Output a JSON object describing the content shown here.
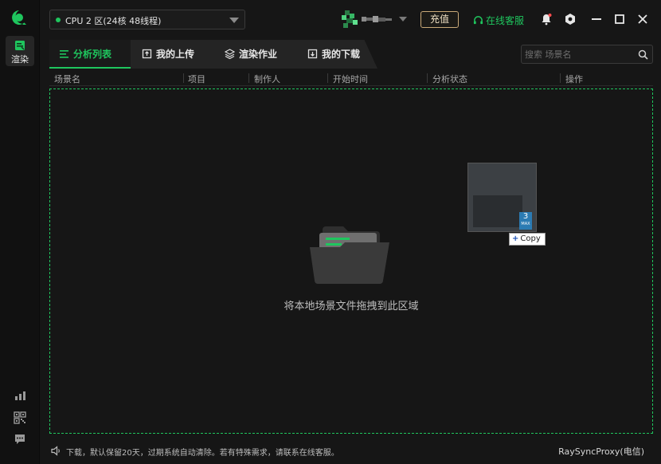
{
  "rail": {
    "render_label": "渲染"
  },
  "topbar": {
    "cpu_zone": "CPU 2 区(24核 48线程)",
    "recharge_label": "充值",
    "support_label": "在线客服"
  },
  "tabs": [
    {
      "label": "分析列表",
      "icon": "list-icon",
      "active": true
    },
    {
      "label": "我的上传",
      "icon": "upload-icon",
      "active": false
    },
    {
      "label": "渲染作业",
      "icon": "layers-icon",
      "active": false
    },
    {
      "label": "我的下载",
      "icon": "download-icon",
      "active": false
    }
  ],
  "search": {
    "placeholder": "搜索 场景名"
  },
  "table": {
    "columns": [
      "场景名",
      "项目",
      "制作人",
      "开始时间",
      "分析状态",
      "操作"
    ]
  },
  "dropzone": {
    "hint": "将本地场景文件拖拽到此区域"
  },
  "drag": {
    "badge_number": "3",
    "badge_sub": "MAX",
    "copy_label": "Copy"
  },
  "status": {
    "message": "下载，默认保留20天，过期系统自动清除。若有特殊需求，请联系在线客服。",
    "proxy": "RaySyncProxy(电信)"
  },
  "colors": {
    "accent": "#1fc65e",
    "recharge_border": "#c9a978",
    "background": "#161616"
  }
}
